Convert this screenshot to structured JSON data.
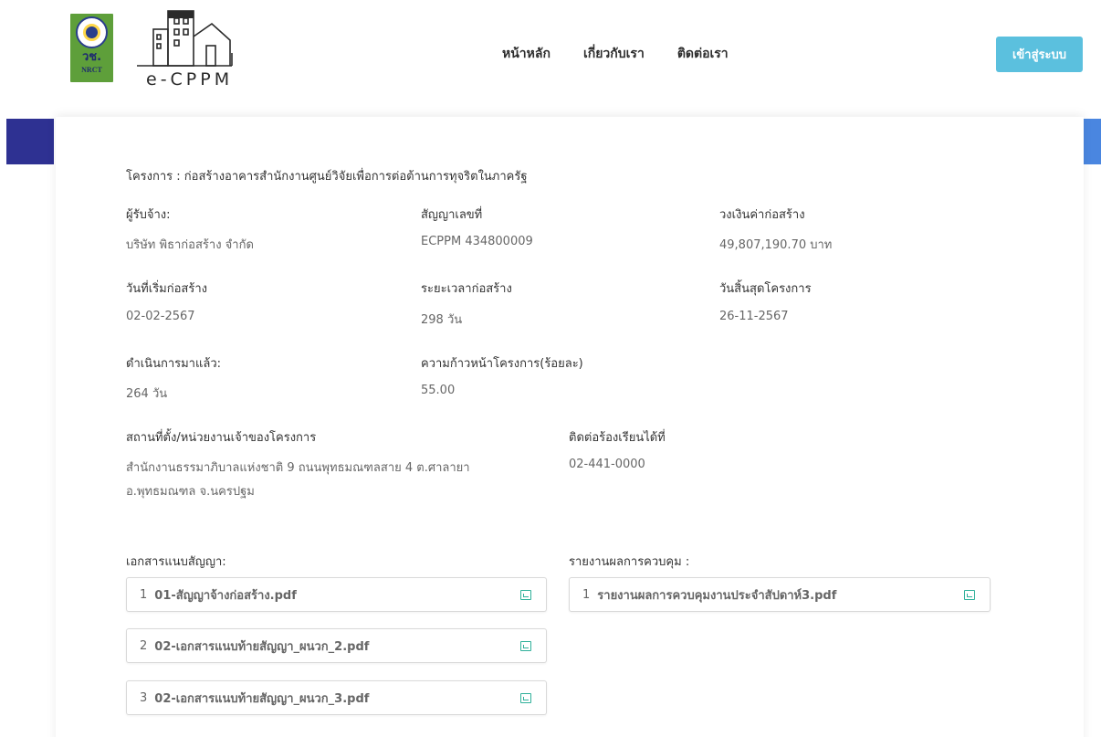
{
  "header": {
    "nrct_logo_text_th": "วช.",
    "nrct_logo_text_en": "NRCT",
    "app_logo_text": "e-CPPM",
    "nav": [
      "หน้าหลัก",
      "เกี่ยวกับเรา",
      "ติดต่อเรา"
    ],
    "login_label": "เข้าสู่ระบบ"
  },
  "project": {
    "title": "โครงการ : ก่อสร้างอาคารสำนักงานศูนย์วิจัยเพื่อการต่อต้านการทุจริตในภาครัฐ",
    "contractor_label": "ผู้รับจ้าง:",
    "contractor_value": "บริษัท พิธาก่อสร้าง จำกัด",
    "contract_no_label": "สัญญาเลขที่",
    "contract_no_value": "ECPPM 434800009",
    "budget_label": "วงเงินค่าก่อสร้าง",
    "budget_value": "49,807,190.70 บาท",
    "start_label": "วันที่เริ่มก่อสร้าง",
    "start_value": "02-02-2567",
    "duration_label": "ระยะเวลาก่อสร้าง",
    "duration_value": "298 วัน",
    "end_label": "วันสิ้นสุดโครงการ",
    "end_value": "26-11-2567",
    "elapsed_label": "ดำเนินการมาแล้ว:",
    "elapsed_value": "264 วัน",
    "progress_label": "ความก้าวหน้าโครงการ(ร้อยละ)",
    "progress_value": "55.00",
    "location_label": "สถานที่ตั้ง/หน่วยงานเจ้าของโครงการ",
    "location_line1": "สำนักงานธรรมาภิบาลแห่งชาติ 9 ถนนพุทธมณฑลสาย 4 ต.ศาลายา",
    "location_line2": "อ.พุทธมณฑล จ.นครปฐม",
    "contact_label": "ติดต่อร้องเรียนได้ที่",
    "contact_value": "02-441-0000"
  },
  "attachments": {
    "label": "เอกสารแนบสัญญา:",
    "items": [
      {
        "num": "1",
        "name": "01-สัญญาจ้างก่อสร้าง.pdf"
      },
      {
        "num": "2",
        "name": "02-เอกสารแนบท้ายสัญญา_ผนวก_2.pdf"
      },
      {
        "num": "3",
        "name": "02-เอกสารแนบท้ายสัญญา_ผนวก_3.pdf"
      }
    ]
  },
  "reports": {
    "label": "รายงานผลการควบคุม :",
    "items": [
      {
        "num": "1",
        "name": "รายงานผลการควบคุมงานประจำสัปดาห์3.pdf"
      }
    ]
  },
  "colors": {
    "login_button": "#5bc0de",
    "accent_left": "#2e3192",
    "accent_right": "#4a86e0",
    "nrct_green": "#5e9f3a",
    "download_icon": "#2fb09a"
  }
}
